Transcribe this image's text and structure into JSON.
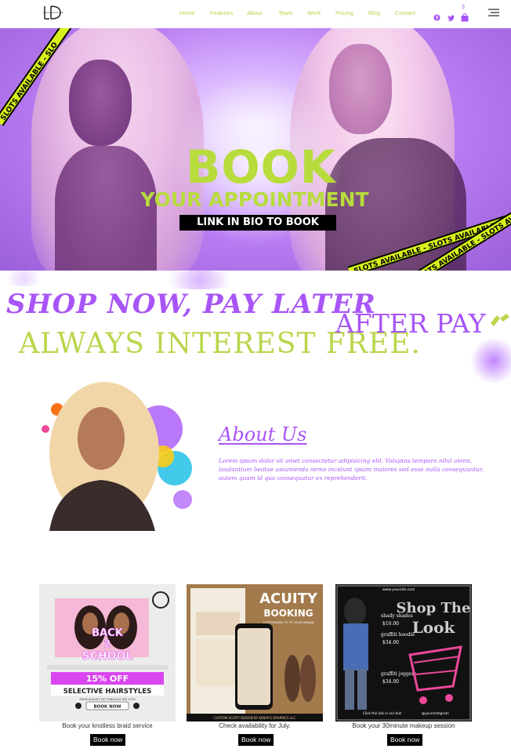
{
  "header": {
    "logo_text": "LD",
    "nav": [
      "Home",
      "Features",
      "About",
      "Team",
      "Work",
      "Pricing",
      "Blog",
      "Contact"
    ],
    "cart_count": "3",
    "icons": [
      "facebook-icon",
      "twitter-icon",
      "shopping-bag-icon",
      "hamburger-menu-icon"
    ]
  },
  "hero": {
    "title": "BOOK",
    "subtitle": "YOUR APPOINTMENT",
    "link_text": "LINK IN BIO TO BOOK",
    "tape_text": "SLOTS AVAILABLE - SLOTS AVAILABLE",
    "tape_text_short": "SLOTS AVAILABLE - SLO",
    "tape_text_right2": "SLOTS AVAILABLE - SLOTS AVAILABLE"
  },
  "promo": {
    "line1": "SHOP NOW, PAY LATER",
    "line2": "ALWAYS INTEREST FREE.",
    "afterpay": "AFTER PAY"
  },
  "about": {
    "title": "About Us",
    "body": "Lorem ipsum dolor sit amet consectetur adipisicing elit. Voluptas tempora nihil animi, laudantium beatae assumenda nemo incidunt ipsam maiores sed esse nulla consequuntur, autem quam id quo consequatur ex reprehenderit."
  },
  "cards": [
    {
      "caption": "Book your knotless braid service",
      "button": "Book now",
      "flyer": {
        "line1": "BACK",
        "line2": "2",
        "line3": "SCHOOL",
        "discount": "15% OFF",
        "service": "SELECTIVE HAIRSTYLES",
        "date": "FROM AUGUST 1ST THROUGH THE 17TH",
        "cta": "BOOK NOW"
      }
    },
    {
      "caption": "Check availability for July.",
      "button": "Book now",
      "flyer": {
        "brand": "ACUITY",
        "brand2": "BOOKING",
        "tagline": "CUSTOMIZED TO FIT YOUR BRAND",
        "footer": "CUSTOM ACUITY DESIGN BY KENYA'S GRAPHICS LLC"
      }
    },
    {
      "caption": "Book your 30minute makeup session",
      "button": "Book now",
      "flyer": {
        "url": "www.yoursite.com",
        "title1": "Shop The",
        "title2": "Look",
        "item1": "shady shades",
        "price1": "$10.00",
        "item2": "graffiti hoodie",
        "price2": "$34.00",
        "item3": "graffiti joggers",
        "price3": "$34.00",
        "footer": "Click the link in our bio!",
        "handle": "@yourinstagram"
      }
    }
  ],
  "colors": {
    "purple": "#a855f7",
    "lime": "#b9d64c",
    "tape": "#d8f01a"
  }
}
